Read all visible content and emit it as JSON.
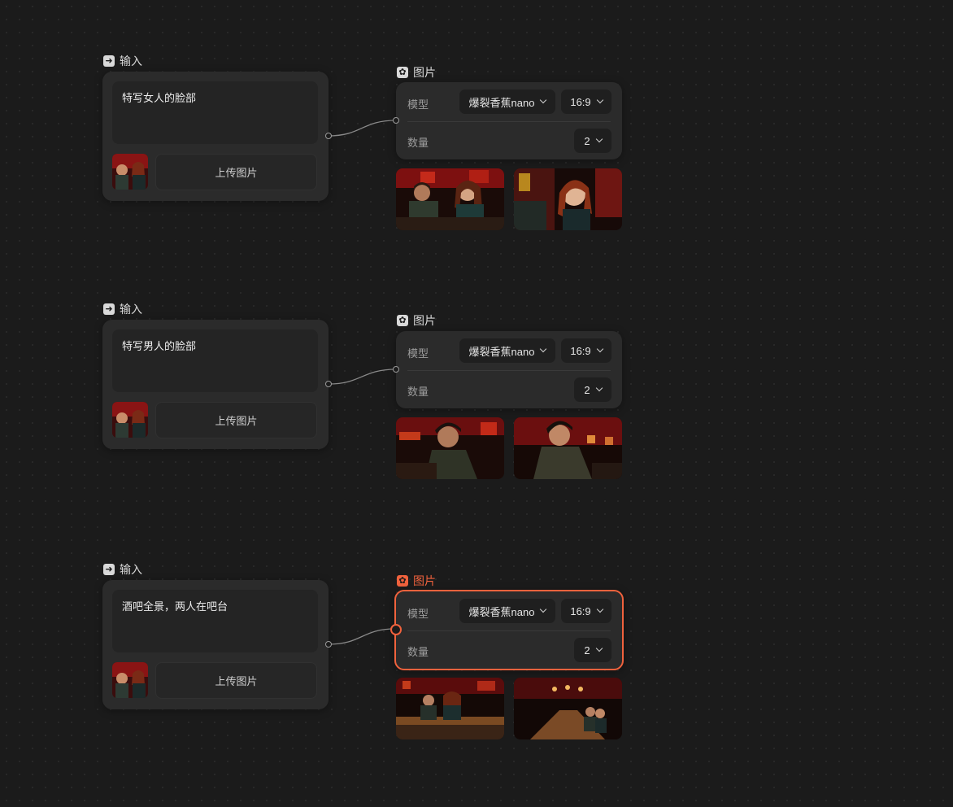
{
  "colors": {
    "canvas_bg": "#1b1b1b",
    "card_bg": "#2b2b2b",
    "accent": "#f0623d"
  },
  "icons": {
    "input_node": "input-arrow-icon",
    "image_node": "image-icon",
    "dropdown": "chevron-down-icon"
  },
  "workflows": [
    {
      "input": {
        "label": "输入",
        "prompt": "特写女人的脸部",
        "upload_label": "上传图片"
      },
      "image": {
        "label": "图片",
        "active": false,
        "model_label": "模型",
        "model_value": "爆裂香蕉nano",
        "ratio_value": "16:9",
        "count_label": "数量",
        "count_value": "2"
      }
    },
    {
      "input": {
        "label": "输入",
        "prompt": "特写男人的脸部",
        "upload_label": "上传图片"
      },
      "image": {
        "label": "图片",
        "active": false,
        "model_label": "模型",
        "model_value": "爆裂香蕉nano",
        "ratio_value": "16:9",
        "count_label": "数量",
        "count_value": "2"
      }
    },
    {
      "input": {
        "label": "输入",
        "prompt": "酒吧全景，两人在吧台",
        "upload_label": "上传图片"
      },
      "image": {
        "label": "图片",
        "active": true,
        "model_label": "模型",
        "model_value": "爆裂香蕉nano",
        "ratio_value": "16:9",
        "count_label": "数量",
        "count_value": "2"
      }
    }
  ]
}
